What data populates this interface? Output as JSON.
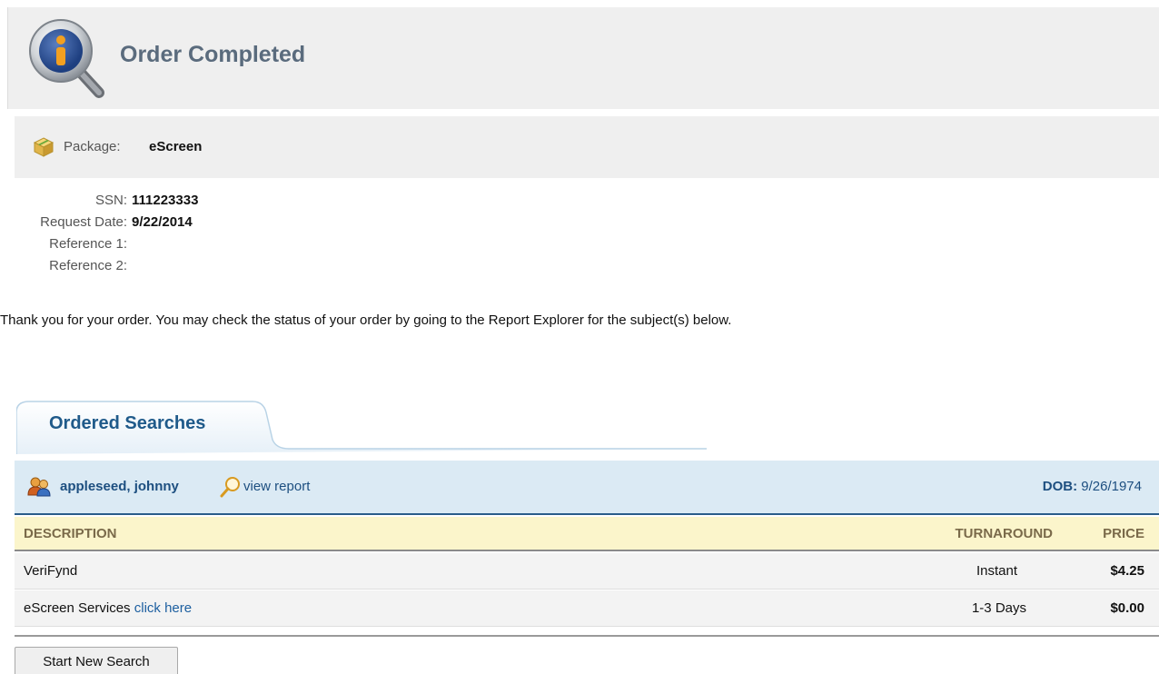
{
  "header": {
    "title": "Order Completed",
    "icon": "info-magnifier-icon"
  },
  "package": {
    "label": "Package:",
    "value": "eScreen",
    "icon": "package-box-icon"
  },
  "details": [
    {
      "label": "SSN:",
      "value": "111223333"
    },
    {
      "label": "Request Date:",
      "value": "9/22/2014"
    },
    {
      "label": "Reference 1:",
      "value": ""
    },
    {
      "label": "Reference 2:",
      "value": ""
    }
  ],
  "message": "Thank you for your order. You may check the status of your order by going to the Report Explorer for the subject(s) below.",
  "tab": {
    "label": "Ordered Searches"
  },
  "subject": {
    "name": "appleseed, johnny",
    "view_link": "view report",
    "dob_label": "DOB:",
    "dob_value": "9/26/1974",
    "icon": "people-icon",
    "view_icon": "magnifier-icon"
  },
  "table": {
    "headers": {
      "description": "DESCRIPTION",
      "turnaround": "TURNAROUND",
      "price": "PRICE"
    },
    "rows": [
      {
        "description": "VeriFynd",
        "link": "",
        "turnaround": "Instant",
        "price": "$4.25"
      },
      {
        "description": "eScreen Services",
        "link": "click here",
        "turnaround": "1-3 Days",
        "price": "$0.00"
      }
    ]
  },
  "actions": {
    "start_new_search": "Start New Search"
  },
  "colors": {
    "header_bg": "#efefef",
    "title": "#5a6b7d",
    "link": "#1d4f80",
    "subject_bg": "#dbeaf4",
    "table_head_bg": "#fbf5cb"
  }
}
